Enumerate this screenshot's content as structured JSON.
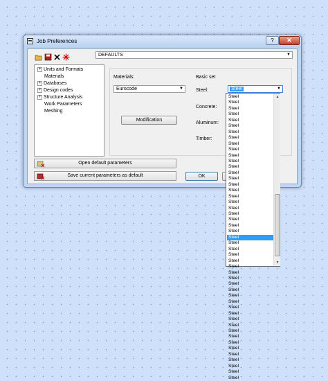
{
  "window": {
    "title": "Job Preferences",
    "help_label": "?",
    "close_label": "✕"
  },
  "toolbar": {
    "config_value": "DEFAULTS",
    "icons": [
      "open-folder-icon",
      "save-icon",
      "delete-icon",
      "new-icon"
    ]
  },
  "tree": [
    {
      "label": "Units and Formats",
      "expandable": true
    },
    {
      "label": "Materials",
      "expandable": false
    },
    {
      "label": "Databases",
      "expandable": true
    },
    {
      "label": "Design codes",
      "expandable": true
    },
    {
      "label": "Structure Analysis",
      "expandable": true
    },
    {
      "label": "Work Parameters",
      "expandable": false
    },
    {
      "label": "Meshing",
      "expandable": false
    }
  ],
  "materials": {
    "label": "Materials:",
    "selected": "Eurocode",
    "modification_button": "Modification"
  },
  "basic_set": {
    "label": "Basic set",
    "steel_label": "Steel:",
    "steel_value": "Steel",
    "concrete_label": "Concrete:",
    "aluminum_label": "Aluminum:",
    "timber_label": "Timber:"
  },
  "buttons": {
    "open_default": "Open default parameters",
    "save_default": "Save current parameters as default",
    "ok": "OK"
  },
  "dropdown": {
    "items": [
      "Steel",
      "Steel",
      "Steel",
      "Steel",
      "Steel",
      "Steel",
      "Steel",
      "Steel",
      "Steel",
      "Steel",
      "Steel",
      "Steel",
      "Steel",
      "Steel",
      "Steel",
      "Steel",
      "Steel",
      "Steel",
      "Steel",
      "Steel",
      "Steel",
      "Steel",
      "Steel",
      "Steel",
      "Steel",
      "Steel",
      "Steel",
      "Steel",
      "Steel",
      "Steel",
      "Steel",
      "Steel",
      "Steel",
      "Steel",
      "Steel",
      "Steel",
      "Steel",
      "Steel",
      "Steel",
      "Steel",
      "Steel",
      "Steel",
      "Steel",
      "Steel",
      "Steel",
      "Steel",
      "Steel",
      "Steel",
      "Steel"
    ],
    "selected_index": 24
  },
  "colors": {
    "selection": "#3399ff",
    "desktop": "#cfe0fa",
    "window_frame": "#bfd6f1"
  }
}
